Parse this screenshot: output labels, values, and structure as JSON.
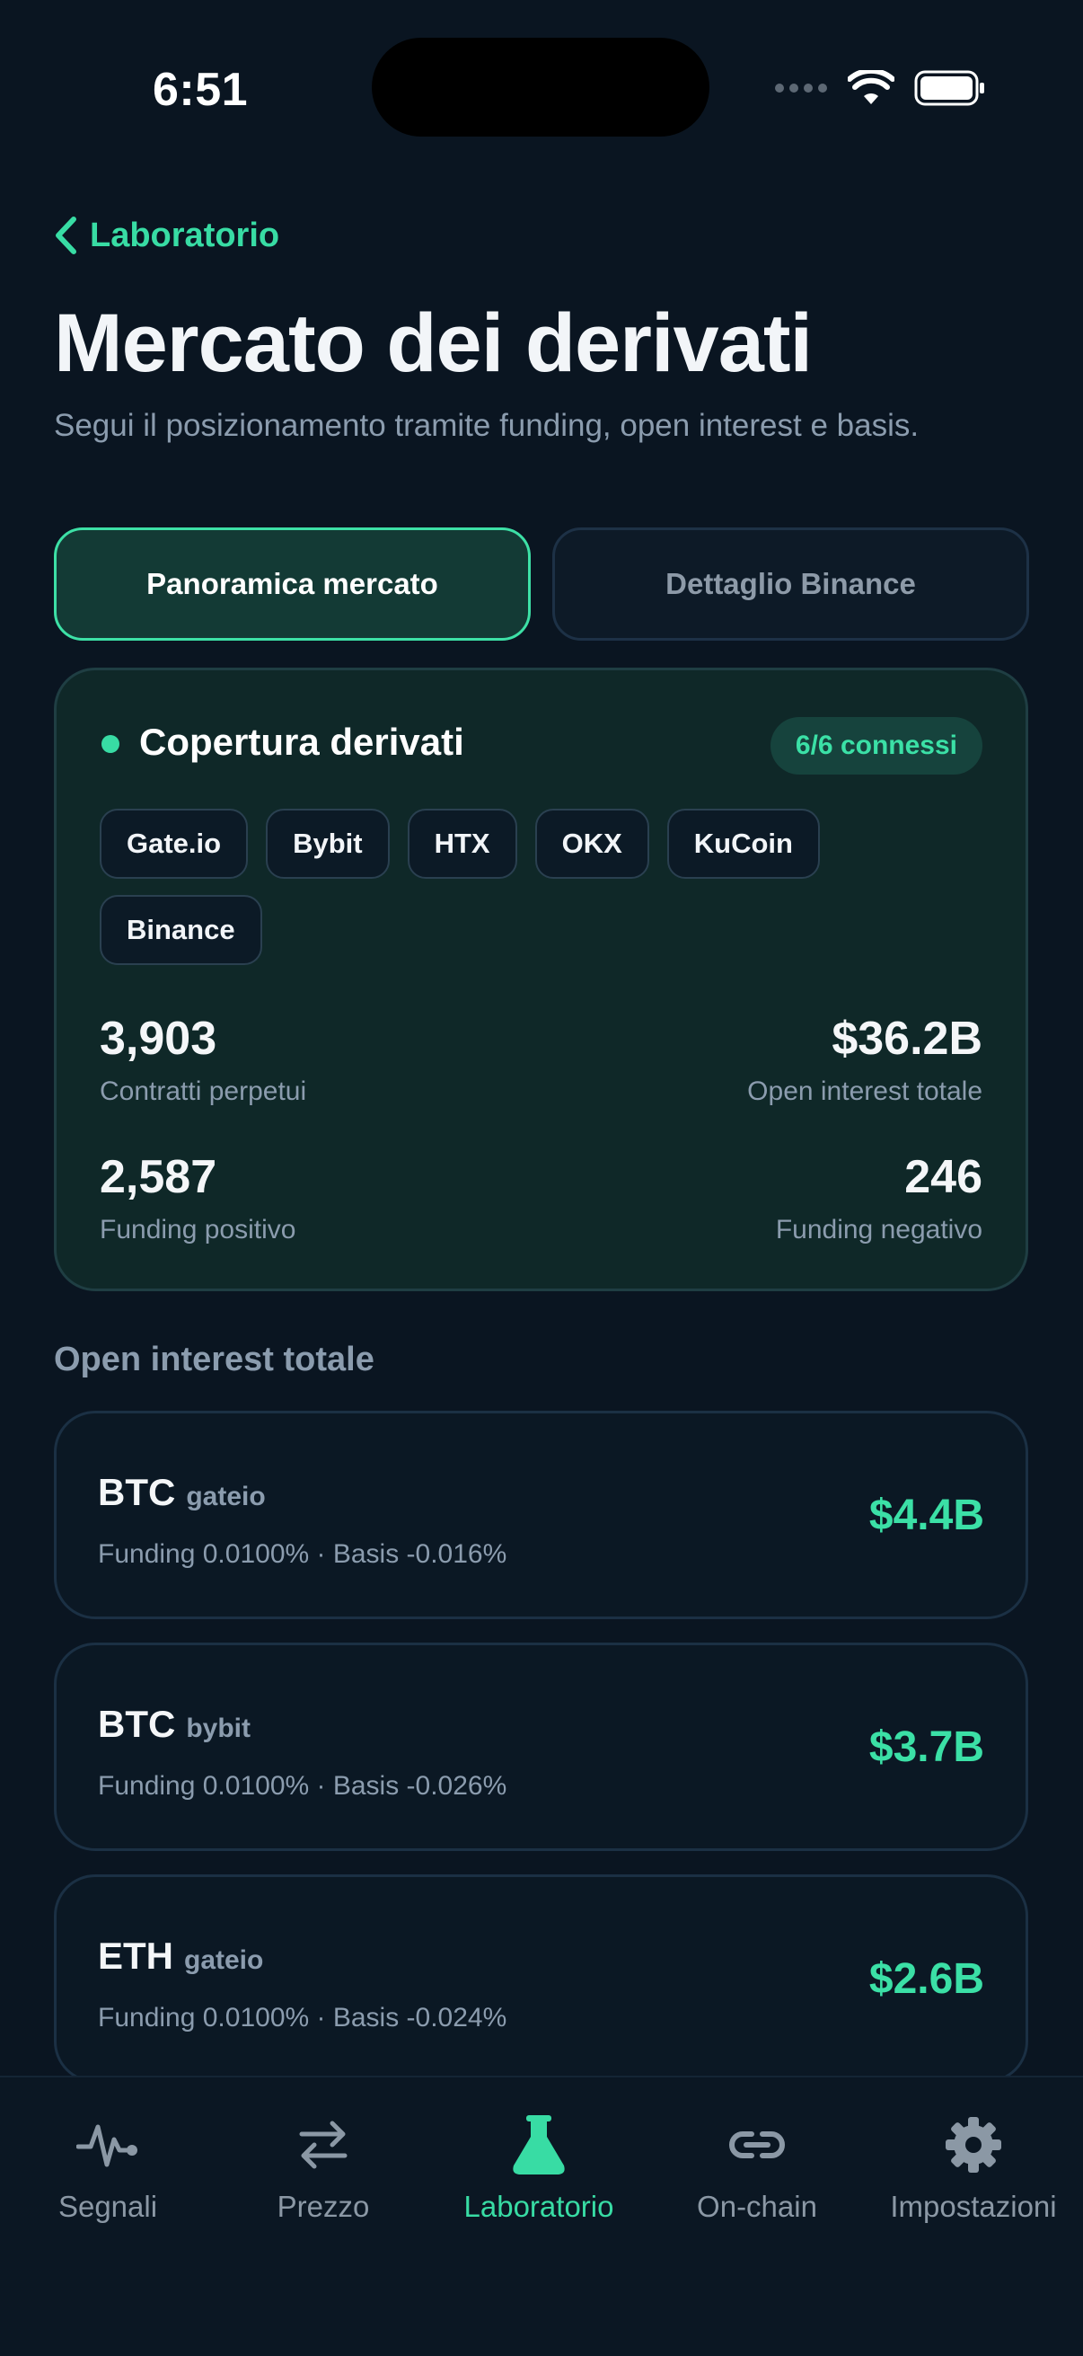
{
  "status_bar": {
    "time": "6:51"
  },
  "nav": {
    "back_label": "Laboratorio"
  },
  "header": {
    "title": "Mercato dei derivati",
    "subtitle": "Segui il posizionamento tramite funding, open interest e basis."
  },
  "segments": [
    {
      "label": "Panoramica mercato",
      "active": true
    },
    {
      "label": "Dettaglio Binance",
      "active": false
    }
  ],
  "coverage": {
    "title": "Copertura derivati",
    "badge": "6/6 connessi",
    "exchanges": [
      "Gate.io",
      "Bybit",
      "HTX",
      "OKX",
      "KuCoin",
      "Binance"
    ],
    "stats": [
      {
        "value": "3,903",
        "label": "Contratti perpetui"
      },
      {
        "value": "$36.2B",
        "label": "Open interest totale"
      },
      {
        "value": "2,587",
        "label": "Funding positivo"
      },
      {
        "value": "246",
        "label": "Funding negativo"
      }
    ]
  },
  "open_interest": {
    "section_title": "Open interest totale",
    "items": [
      {
        "symbol": "BTC",
        "exchange": "gateio",
        "detail": "Funding 0.0100% · Basis -0.016%",
        "value": "$4.4B"
      },
      {
        "symbol": "BTC",
        "exchange": "bybit",
        "detail": "Funding 0.0100% · Basis -0.026%",
        "value": "$3.7B"
      },
      {
        "symbol": "ETH",
        "exchange": "gateio",
        "detail": "Funding 0.0100% · Basis -0.024%",
        "value": "$2.6B"
      }
    ]
  },
  "tab_bar": {
    "items": [
      {
        "label": "Segnali",
        "icon": "pulse-icon"
      },
      {
        "label": "Prezzo",
        "icon": "swap-arrows-icon"
      },
      {
        "label": "Laboratorio",
        "icon": "flask-icon",
        "active": true
      },
      {
        "label": "On-chain",
        "icon": "link-icon"
      },
      {
        "label": "Impostazioni",
        "icon": "gear-icon"
      }
    ]
  },
  "colors": {
    "accent": "#38dca4",
    "background": "#0a1521",
    "muted": "#8b9cae"
  }
}
